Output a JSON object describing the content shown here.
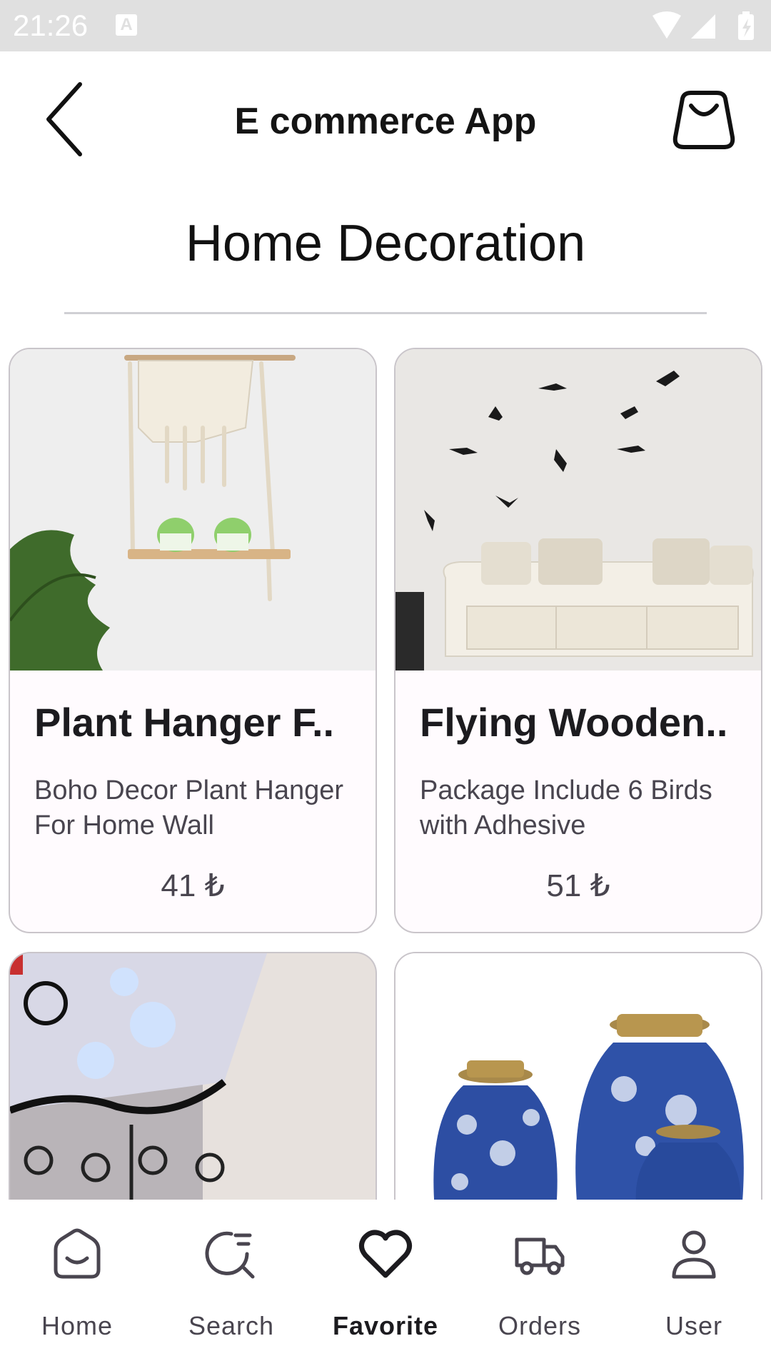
{
  "status_bar": {
    "time": "21:26",
    "notification_glyph": "A"
  },
  "app_bar": {
    "title": "E commerce App",
    "back_icon": "chevron-left-icon",
    "cart_icon": "shopping-bag-icon"
  },
  "page": {
    "title": "Home Decoration"
  },
  "products": [
    {
      "name": "Plant Hanger F..",
      "description": "Boho Decor Plant Hanger For Home Wall",
      "price": "41 ₺"
    },
    {
      "name": "Flying Wooden..",
      "description": "Package Include 6 Birds with Adhesive",
      "price": "51 ₺"
    },
    {
      "name": "",
      "description": "",
      "price": ""
    },
    {
      "name": "",
      "description": "",
      "price": ""
    }
  ],
  "bottom_nav": {
    "active": "Favorite",
    "items": [
      {
        "label": "Home",
        "icon": "home-icon"
      },
      {
        "label": "Search",
        "icon": "search-icon"
      },
      {
        "label": "Favorite",
        "icon": "heart-icon"
      },
      {
        "label": "Orders",
        "icon": "truck-icon"
      },
      {
        "label": "User",
        "icon": "user-icon"
      }
    ]
  },
  "colors": {
    "status_bar": "#e0e0e0",
    "card_border": "#c9c5ca",
    "card_bg": "#fffbfe",
    "text_primary": "#1c1b1f",
    "text_secondary": "#49454f"
  }
}
